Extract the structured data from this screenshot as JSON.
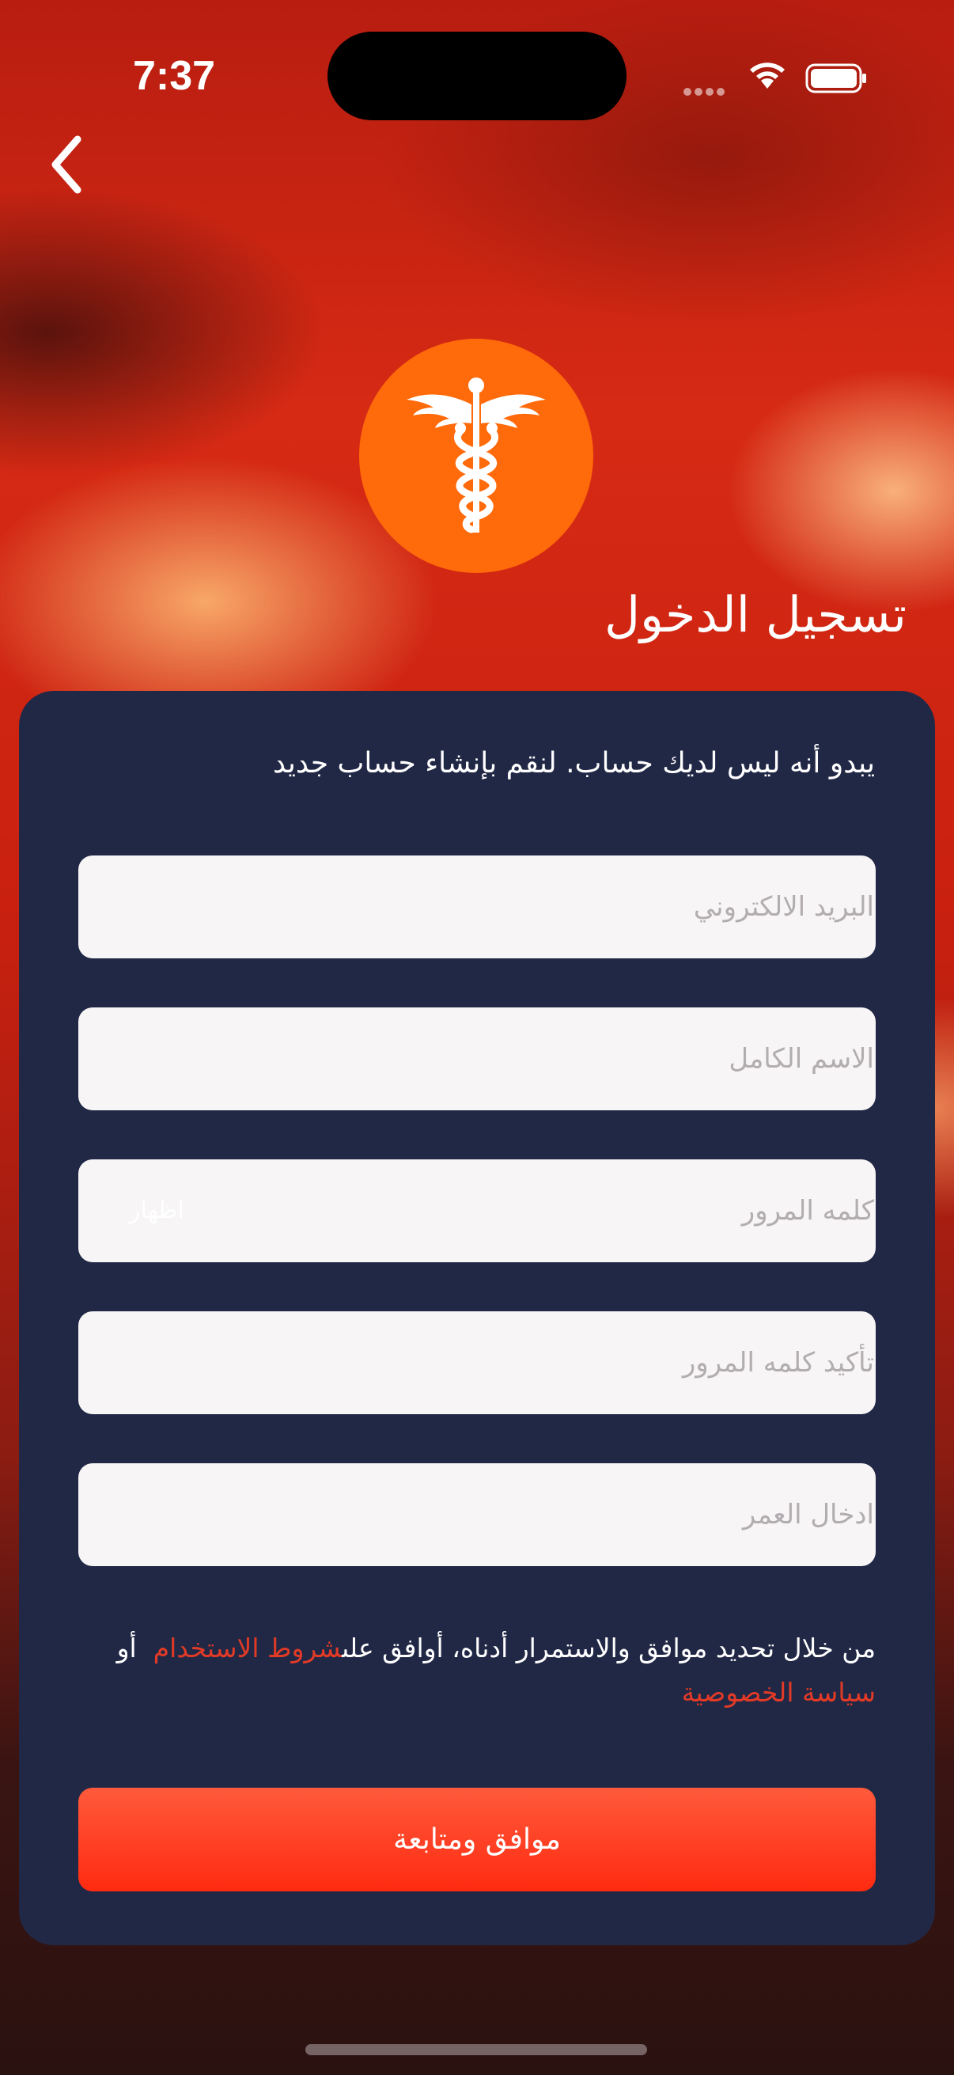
{
  "status_bar": {
    "time": "7:37"
  },
  "header": {
    "title": "تسجيل الدخول"
  },
  "form": {
    "subtitle": "يبدو أنه ليس لديك حساب. لنقم بإنشاء حساب جديد",
    "fields": [
      {
        "placeholder": "البريد الالكتروني"
      },
      {
        "placeholder": "الاسم الكامل"
      },
      {
        "placeholder": "كلمه المرور",
        "toggle_label": "اظهار"
      },
      {
        "placeholder": "تأكيد كلمه المرور"
      },
      {
        "placeholder": "ادخال العمر"
      }
    ],
    "terms_prefix": "من خلال تحديد موافق والاستمرار أدناه، أوافق على",
    "terms_link": "شروط الاستخدام",
    "terms_or": "أو",
    "privacy_link": "سياسة الخصوصية",
    "continue_label": "موافق ومتابعة"
  },
  "colors": {
    "card": "#212846",
    "accent": "#ff6a0a",
    "link": "#e23a26",
    "button": "#ff2a10"
  }
}
